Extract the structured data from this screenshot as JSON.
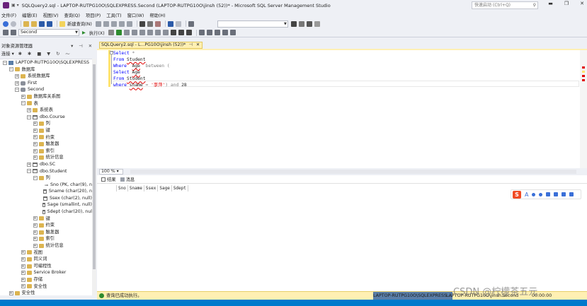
{
  "window": {
    "title": "SQLQuery2.sql - LAPTOP-RUTPG10O\\SQLEXPRESS.Second (LAPTOP-RUTPG10O\\jinsh (52))* - Microsoft SQL Server Management Studio",
    "quick_launch_placeholder": "快速启动 (Ctrl+Q)",
    "minimize": "▬",
    "restore": "❐",
    "close": "✕"
  },
  "menu": [
    "文件(F)",
    "编辑(E)",
    "视图(V)",
    "查询(Q)",
    "项目(P)",
    "工具(T)",
    "窗口(W)",
    "帮助(H)"
  ],
  "toolbar": {
    "new_query": "新建查询(N)",
    "database_combo": "Second",
    "execute": "执行(X)"
  },
  "object_explorer": {
    "title": "对象资源管理器",
    "pins": "▾ ⊣ ✕",
    "connect": "连接 ▾",
    "tree": [
      {
        "level": 0,
        "toggle": "−",
        "icon": "server",
        "label": "LAPTOP-RUTPG10O\\SQLEXPRESS"
      },
      {
        "level": 1,
        "toggle": "−",
        "icon": "folder",
        "label": "数据库"
      },
      {
        "level": 2,
        "toggle": "+",
        "icon": "folder",
        "label": "系统数据库"
      },
      {
        "level": 2,
        "toggle": "+",
        "icon": "db",
        "label": "First"
      },
      {
        "level": 2,
        "toggle": "−",
        "icon": "db",
        "label": "Second"
      },
      {
        "level": 3,
        "toggle": "+",
        "icon": "folder",
        "label": "数据库关系图"
      },
      {
        "level": 3,
        "toggle": "−",
        "icon": "folder",
        "label": "表"
      },
      {
        "level": 4,
        "toggle": "+",
        "icon": "folder",
        "label": "系统表"
      },
      {
        "level": 4,
        "toggle": "−",
        "icon": "table",
        "label": "dbo.Course"
      },
      {
        "level": 5,
        "toggle": "+",
        "icon": "folder",
        "label": "列"
      },
      {
        "level": 5,
        "toggle": "+",
        "icon": "folder",
        "label": "键"
      },
      {
        "level": 5,
        "toggle": "+",
        "icon": "folder",
        "label": "约束"
      },
      {
        "level": 5,
        "toggle": "+",
        "icon": "folder",
        "label": "触发器"
      },
      {
        "level": 5,
        "toggle": "+",
        "icon": "folder",
        "label": "索引"
      },
      {
        "level": 5,
        "toggle": "+",
        "icon": "folder",
        "label": "统计信息"
      },
      {
        "level": 4,
        "toggle": "+",
        "icon": "table",
        "label": "dbo.SC"
      },
      {
        "level": 4,
        "toggle": "−",
        "icon": "table",
        "label": "dbo.Student"
      },
      {
        "level": 5,
        "toggle": "−",
        "icon": "folder",
        "label": "列"
      },
      {
        "level": 6,
        "toggle": "",
        "icon": "key",
        "label": "Sno (PK, char(9), n"
      },
      {
        "level": 6,
        "toggle": "",
        "icon": "table",
        "label": "Sname (char(20), n"
      },
      {
        "level": 6,
        "toggle": "",
        "icon": "table",
        "label": "Ssex (char(2), null)"
      },
      {
        "level": 6,
        "toggle": "",
        "icon": "table",
        "label": "Sage (smallint, null)"
      },
      {
        "level": 6,
        "toggle": "",
        "icon": "table",
        "label": "Sdept (char(20), nul"
      },
      {
        "level": 5,
        "toggle": "+",
        "icon": "folder",
        "label": "键"
      },
      {
        "level": 5,
        "toggle": "+",
        "icon": "folder",
        "label": "约束"
      },
      {
        "level": 5,
        "toggle": "+",
        "icon": "folder",
        "label": "触发器"
      },
      {
        "level": 5,
        "toggle": "+",
        "icon": "folder",
        "label": "索引"
      },
      {
        "level": 5,
        "toggle": "+",
        "icon": "folder",
        "label": "统计信息"
      },
      {
        "level": 3,
        "toggle": "+",
        "icon": "folder",
        "label": "视图"
      },
      {
        "level": 3,
        "toggle": "+",
        "icon": "folder",
        "label": "同义词"
      },
      {
        "level": 3,
        "toggle": "+",
        "icon": "folder",
        "label": "可编程性"
      },
      {
        "level": 3,
        "toggle": "+",
        "icon": "folder",
        "label": "Service Broker"
      },
      {
        "level": 3,
        "toggle": "+",
        "icon": "folder",
        "label": "存储"
      },
      {
        "level": 3,
        "toggle": "+",
        "icon": "folder",
        "label": "安全性"
      },
      {
        "level": 1,
        "toggle": "+",
        "icon": "folder",
        "label": "安全性"
      }
    ]
  },
  "editor": {
    "tab_label": "SQLQuery2.sql - L...PG10O\\jinsh (52))*",
    "tab_pin": "⊣",
    "tab_close": "✕",
    "zoom": "100 %",
    "fold_toggle": "−"
  },
  "results": {
    "tab_results": "结果",
    "tab_messages": "消息",
    "columns": [
      "Sno",
      "Sname",
      "Ssex",
      "Sage",
      "Sdept"
    ]
  },
  "ime": {
    "logo": "S",
    "mode": "A"
  },
  "status": {
    "message": "查询已成功执行。",
    "server": "LAPTOP-RUTPG10O\\SQLEXPRESS ...",
    "user": "LAPTOP-RUTPG10O\\jinsh...",
    "database": "Second",
    "time": "00:00:00"
  },
  "watermark": "CSDN @柠檬茶五元",
  "colors": {
    "accent": "#007acc",
    "tab_active": "#fff0b3",
    "keyword": "#0000ff",
    "string": "#e00000"
  }
}
